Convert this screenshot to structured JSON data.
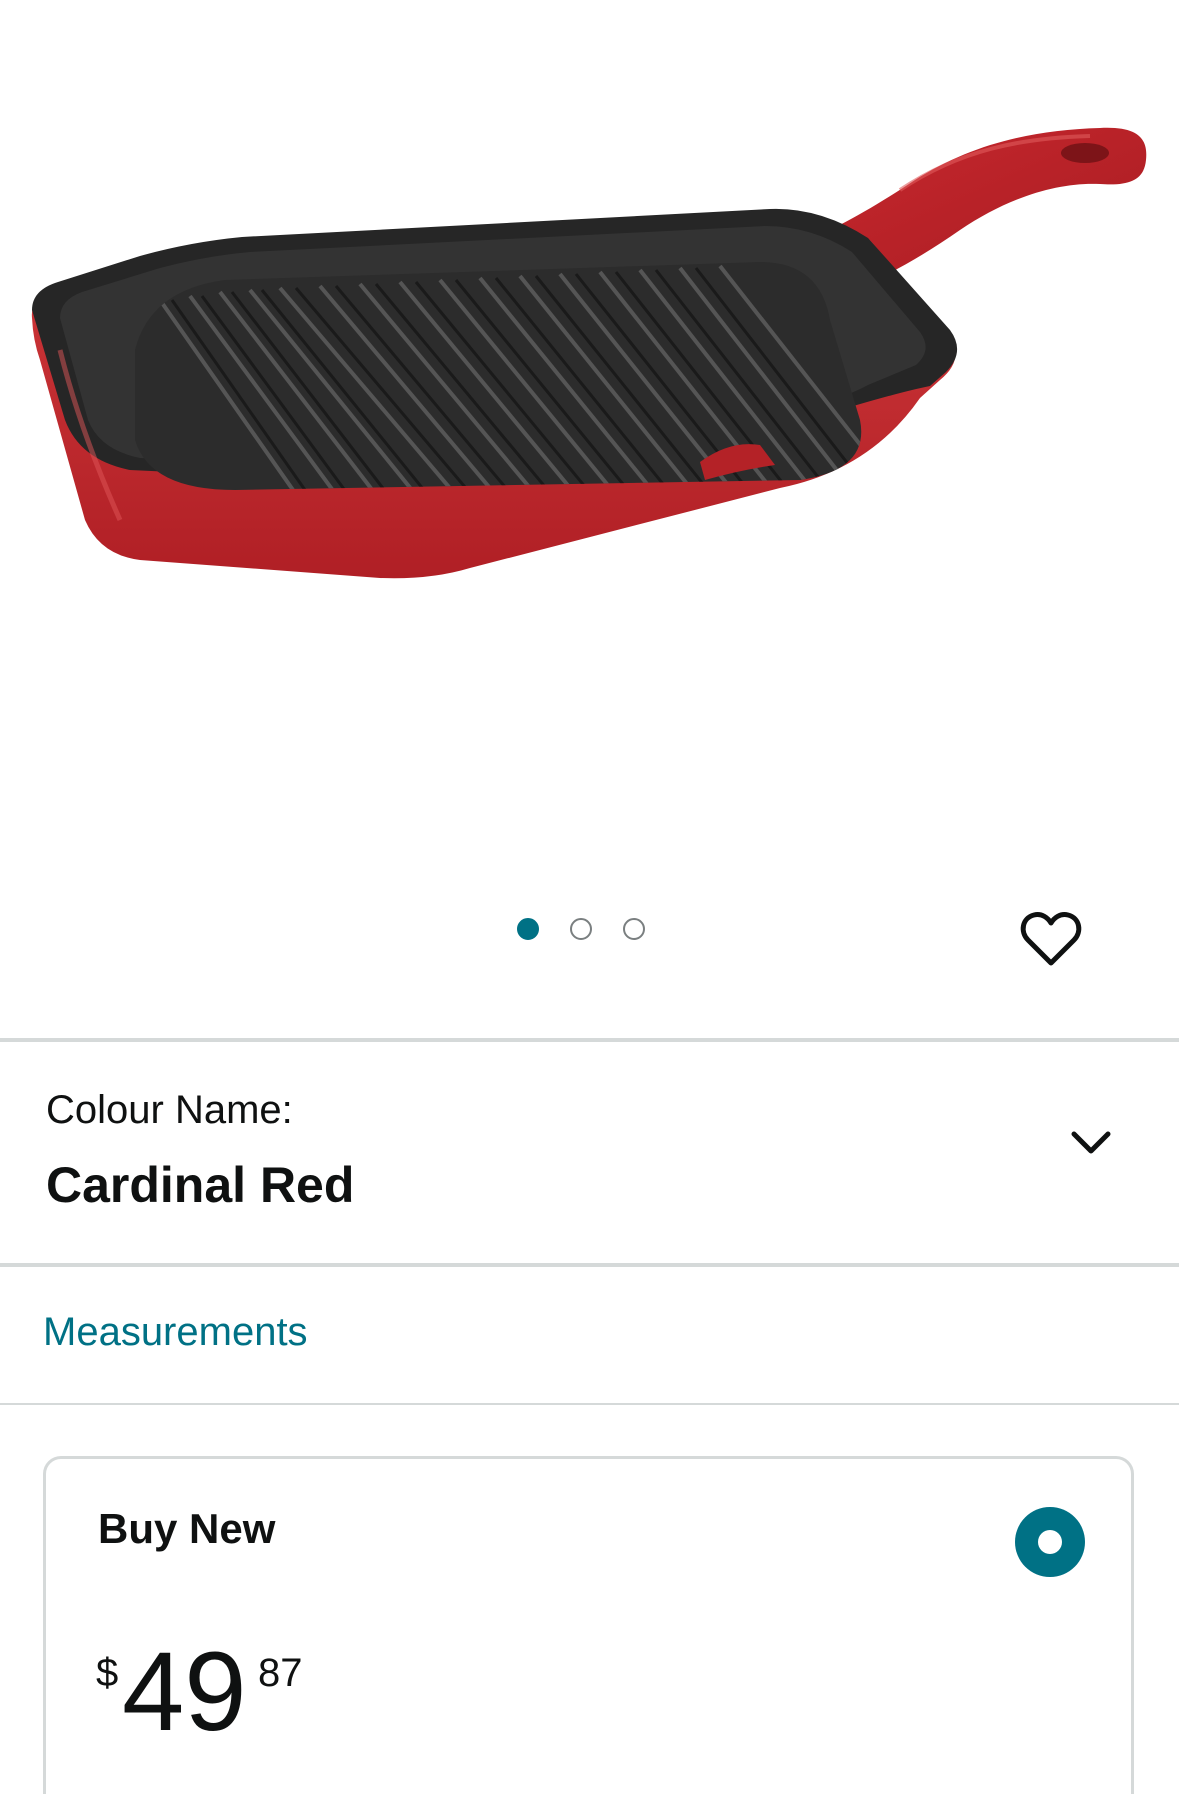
{
  "product": {
    "image_alt": "product-image",
    "carousel": {
      "count": 3,
      "active_index": 0
    }
  },
  "colour": {
    "label": "Colour Name:",
    "value": "Cardinal Red"
  },
  "links": {
    "measurements": "Measurements"
  },
  "buy_box": {
    "title": "Buy New",
    "selected": true,
    "price": {
      "symbol": "$",
      "whole": "49",
      "fraction": "87"
    }
  },
  "colors": {
    "accent": "#007185",
    "divider": "#d5d9d9",
    "pan_red": "#c0262c",
    "pan_black": "#262626"
  },
  "icons": {
    "wishlist": "heart-icon",
    "dropdown": "chevron-down-icon"
  }
}
